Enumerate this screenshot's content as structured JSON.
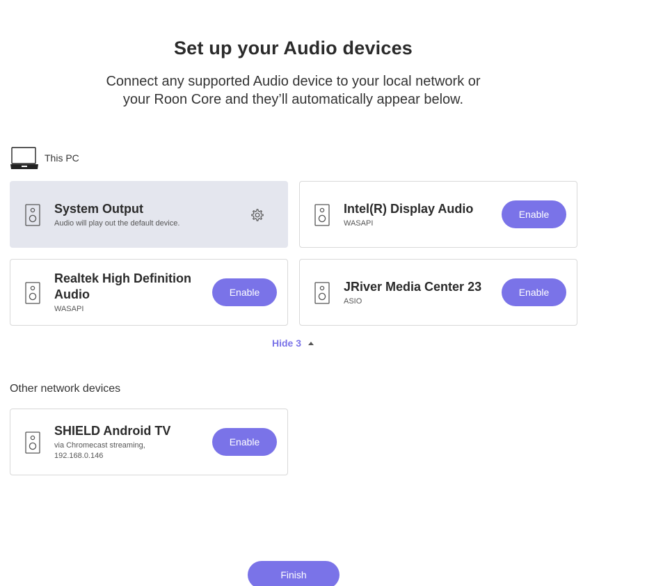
{
  "header": {
    "title": "Set up your Audio devices",
    "subtitle_line1": "Connect any supported Audio device to your local network or",
    "subtitle_line2": "your Roon Core and they’ll automatically appear below."
  },
  "this_pc": {
    "label": "This PC",
    "icon": "laptop-icon",
    "devices": [
      {
        "name": "System Output",
        "subtitle": "Audio will play out the default device.",
        "action": "settings",
        "selected": true,
        "icon": "speaker-icon"
      },
      {
        "name": "Intel(R) Display Audio",
        "subtitle": "WASAPI",
        "action_label": "Enable",
        "icon": "speaker-icon"
      },
      {
        "name": "Realtek High Definition Audio",
        "subtitle": "WASAPI",
        "action_label": "Enable",
        "icon": "speaker-icon"
      },
      {
        "name": "JRiver Media Center 23",
        "subtitle": "ASIO",
        "action_label": "Enable",
        "icon": "speaker-icon"
      }
    ]
  },
  "hide_toggle": {
    "label": "Hide 3",
    "icon": "caret-up-icon"
  },
  "other_network": {
    "label": "Other network devices",
    "devices": [
      {
        "name": "SHIELD Android TV",
        "subtitle": "via Chromecast streaming, 192.168.0.146",
        "action_label": "Enable",
        "icon": "speaker-icon"
      }
    ]
  },
  "footer": {
    "finish_label": "Finish"
  },
  "colors": {
    "accent": "#7a73e8",
    "selected_card": "#e4e6ee",
    "card_border": "#d8d8d8"
  }
}
